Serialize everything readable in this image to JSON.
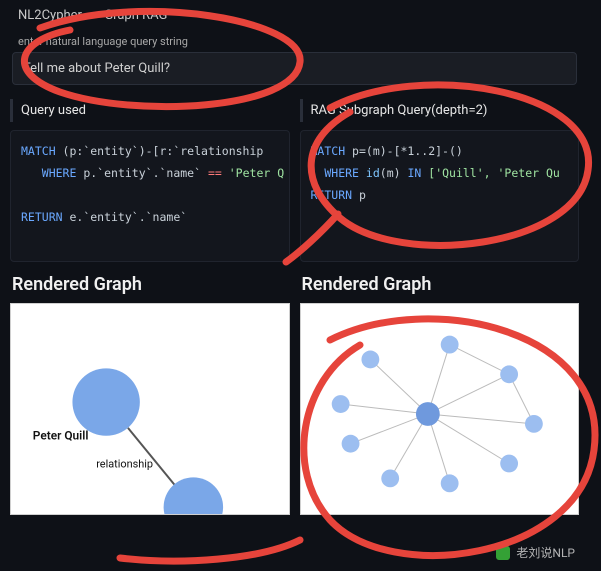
{
  "header": {
    "breadcrumb_left": "NL2Cypher",
    "breadcrumb_right": "Graph RAG"
  },
  "input": {
    "label": "enter natural language query string",
    "value": "Tell me about Peter Quill?"
  },
  "left": {
    "section_title": "Query used",
    "code": {
      "line1_kw": "MATCH",
      "line1_rest": " (p:`entity`)-[r:`relationship",
      "line2_indent": "   ",
      "line2_kw": "WHERE",
      "line2_mid": " p.`entity`.`name` ",
      "line2_op": "==",
      "line2_str": " 'Peter Q",
      "line3_blank": "",
      "line4_kw": "RETURN",
      "line4_rest": " e.`entity`.`name`"
    },
    "rendered_title": "Rendered Graph",
    "graph": {
      "node_label": "Peter Quill",
      "edge_label": "relationship"
    }
  },
  "right": {
    "section_title": "RAG Subgraph Query(depth=2)",
    "code": {
      "line1_kw": "MATCH",
      "line1_rest": " p=(m)-[*1..2]-()",
      "line2_indent": "  ",
      "line2_kw": "WHERE",
      "line2_mid": " ",
      "line2_fn": "id",
      "line2_mid2": "(m) ",
      "line2_in": "IN",
      "line2_str": " ['Quill', 'Peter Qu",
      "line3_kw": "RETURN",
      "line3_rest": " p"
    },
    "rendered_title": "Rendered Graph"
  },
  "watermark": {
    "text": "老刘说NLP"
  },
  "colors": {
    "node_blue": "#7aa7e8",
    "node_blue2": "#9cbef0",
    "annotation_red": "#e6443b"
  }
}
